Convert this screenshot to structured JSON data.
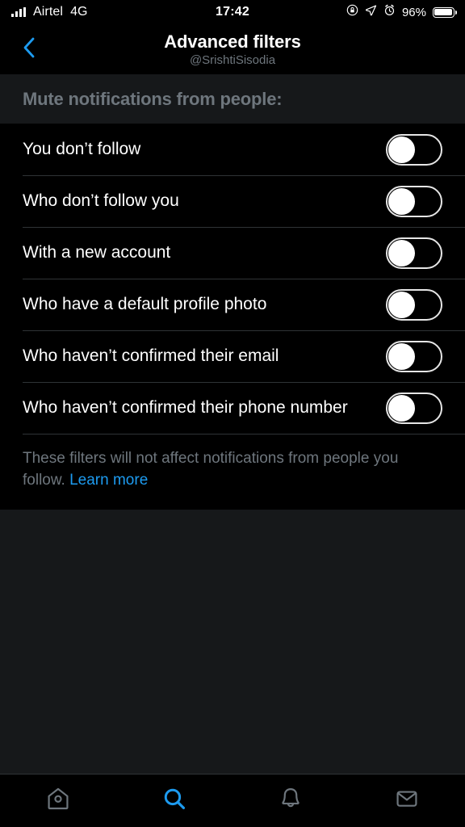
{
  "status_bar": {
    "signal_icon": "cellular-bars-icon",
    "carrier": "Airtel",
    "network": "4G",
    "time": "17:42",
    "rotation_lock_icon": "rotation-lock-icon",
    "location_icon": "location-arrow-icon",
    "alarm_icon": "alarm-clock-icon",
    "battery_percent": "96%",
    "battery_icon": "battery-icon"
  },
  "nav": {
    "back_icon": "chevron-left-icon",
    "title": "Advanced filters",
    "subtitle": "@SrishtiSisodia"
  },
  "section": {
    "heading": "Mute notifications from people:"
  },
  "filters": [
    {
      "label": "You don’t follow",
      "enabled": false
    },
    {
      "label": "Who don’t follow you",
      "enabled": false
    },
    {
      "label": "With a new account",
      "enabled": false
    },
    {
      "label": "Who have a default profile photo",
      "enabled": false
    },
    {
      "label": "Who haven’t confirmed their email",
      "enabled": false
    },
    {
      "label": "Who haven’t confirmed their phone number",
      "enabled": false
    }
  ],
  "footer": {
    "text": "These filters will not affect notifications from people you follow.",
    "link_label": "Learn more"
  },
  "tabbar": {
    "items": [
      {
        "name": "home",
        "icon": "home-birdhouse-icon",
        "active": false
      },
      {
        "name": "search",
        "icon": "search-icon",
        "active": true
      },
      {
        "name": "notifications",
        "icon": "bell-icon",
        "active": false
      },
      {
        "name": "messages",
        "icon": "mail-envelope-icon",
        "active": false
      }
    ]
  },
  "colors": {
    "accent": "#1d9bf0",
    "background": "#000000",
    "surface": "#16181a",
    "text_primary": "#ffffff",
    "text_secondary": "#6e767d",
    "divider": "#2f3336"
  }
}
